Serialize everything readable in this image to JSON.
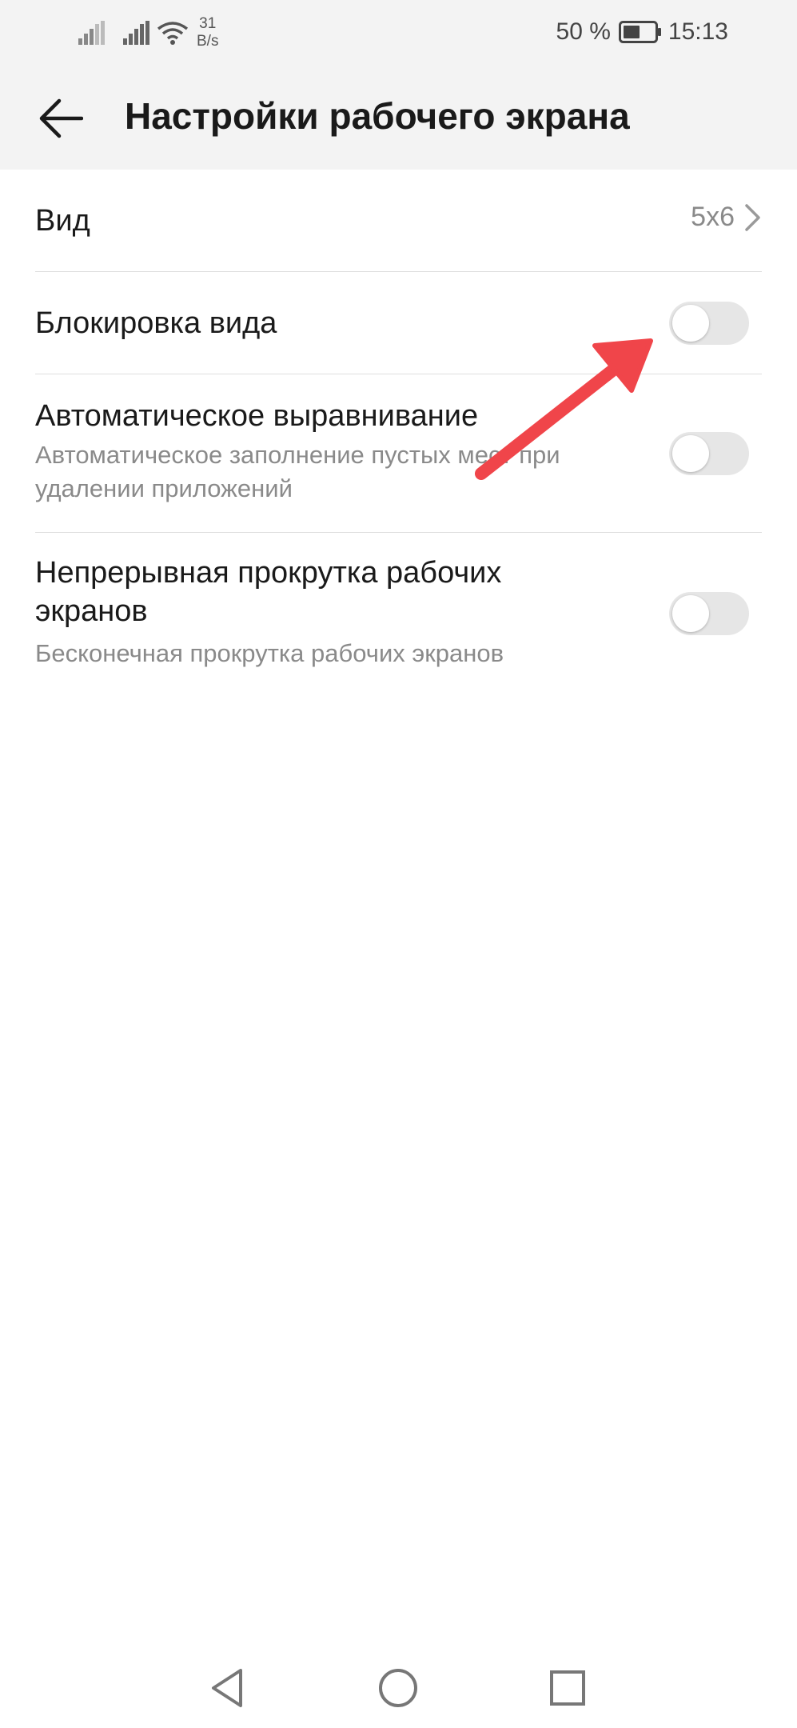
{
  "status_bar": {
    "net_speed_value": "31",
    "net_speed_unit": "B/s",
    "battery_percent": "50 %",
    "time": "15:13"
  },
  "app_bar": {
    "title": "Настройки рабочего экрана",
    "back_icon": "arrow-left-icon"
  },
  "settings": {
    "view": {
      "title": "Вид",
      "value": "5x6"
    },
    "lock_layout": {
      "title": "Блокировка вида",
      "enabled": false
    },
    "auto_align": {
      "title": "Автоматическое выравнивание",
      "subtitle": "Автоматическое заполнение пустых мест при удалении приложений",
      "enabled": false
    },
    "continuous_scroll": {
      "title": "Непрерывная прокрутка рабочих экранов",
      "subtitle": "Бесконечная прокрутка рабочих экранов",
      "enabled": false
    }
  },
  "colors": {
    "accent_arrow": "#f0454a",
    "switch_off_track": "#e6e6e6",
    "bar_background": "#f3f3f3"
  },
  "nav_bar": {
    "icons": [
      "triangle-back-icon",
      "circle-home-icon",
      "square-recent-icon"
    ]
  }
}
